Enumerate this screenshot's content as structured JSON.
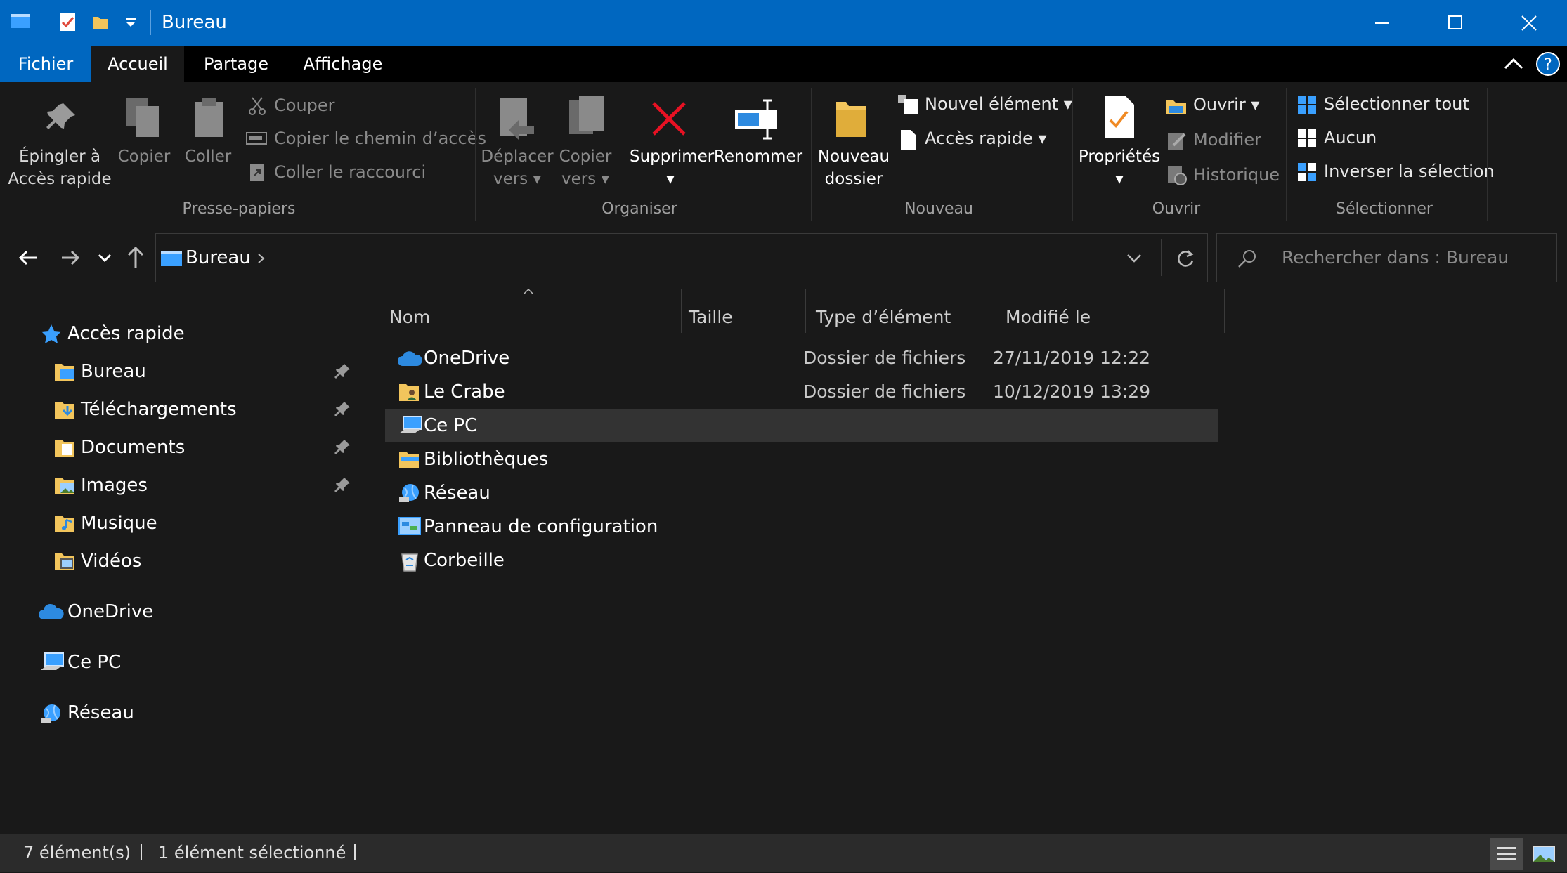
{
  "window": {
    "title": "Bureau",
    "controls": [
      "minimize-icon",
      "maximize-icon",
      "close-icon"
    ]
  },
  "ribbon_tabs": {
    "file": "Fichier",
    "home": "Accueil",
    "share": "Partage",
    "view": "Affichage"
  },
  "ribbon": {
    "clipboard": {
      "pin_line1": "Épingler à",
      "pin_line2": "Accès rapide",
      "copy": "Copier",
      "paste": "Coller",
      "cut": "Couper",
      "copy_path": "Copier le chemin d’accès",
      "paste_shortcut": "Coller le raccourci",
      "group_label": "Presse-papiers"
    },
    "organize": {
      "move_line1": "Déplacer",
      "move_line2": "vers",
      "copyto_line1": "Copier",
      "copyto_line2": "vers",
      "delete": "Supprimer",
      "rename": "Renommer",
      "group_label": "Organiser"
    },
    "new": {
      "new_folder_line1": "Nouveau",
      "new_folder_line2": "dossier",
      "new_item": "Nouvel élément",
      "easy_access": "Accès rapide",
      "group_label": "Nouveau"
    },
    "open": {
      "properties": "Propriétés",
      "open": "Ouvrir",
      "edit": "Modifier",
      "history": "Historique",
      "group_label": "Ouvrir"
    },
    "select": {
      "select_all": "Sélectionner tout",
      "select_none": "Aucun",
      "invert": "Inverser la sélection",
      "group_label": "Sélectionner"
    }
  },
  "address": {
    "location": "Bureau",
    "search_placeholder": "Rechercher dans : Bureau"
  },
  "nav_pane": {
    "quick_access": "Accès rapide",
    "pinned": [
      {
        "label": "Bureau"
      },
      {
        "label": "Téléchargements"
      },
      {
        "label": "Documents"
      },
      {
        "label": "Images"
      }
    ],
    "unpinned": [
      {
        "label": "Musique"
      },
      {
        "label": "Vidéos"
      }
    ],
    "onedrive": "OneDrive",
    "this_pc": "Ce PC",
    "network": "Réseau"
  },
  "columns": {
    "name": "Nom",
    "size": "Taille",
    "type": "Type d’élément",
    "modified": "Modifié le"
  },
  "files": [
    {
      "name": "OneDrive",
      "type": "Dossier de fichiers",
      "modified": "27/11/2019 12:22",
      "icon": "onedrive-icon"
    },
    {
      "name": "Le Crabe",
      "type": "Dossier de fichiers",
      "modified": "10/12/2019 13:29",
      "icon": "user-folder-icon"
    },
    {
      "name": "Ce PC",
      "type": "",
      "modified": "",
      "icon": "computer-icon",
      "selected": true
    },
    {
      "name": "Bibliothèques",
      "type": "",
      "modified": "",
      "icon": "libraries-icon"
    },
    {
      "name": "Réseau",
      "type": "",
      "modified": "",
      "icon": "network-icon"
    },
    {
      "name": "Panneau de configuration",
      "type": "",
      "modified": "",
      "icon": "control-panel-icon"
    },
    {
      "name": "Corbeille",
      "type": "",
      "modified": "",
      "icon": "recycle-bin-icon"
    }
  ],
  "status": {
    "count": "7 élément(s)",
    "selection": "1 élément sélectionné"
  },
  "colors": {
    "accent": "#0067c0",
    "background": "#191919",
    "selection": "#333333",
    "delete_red": "#e81123",
    "folder_yellow": "#f2c55c"
  }
}
